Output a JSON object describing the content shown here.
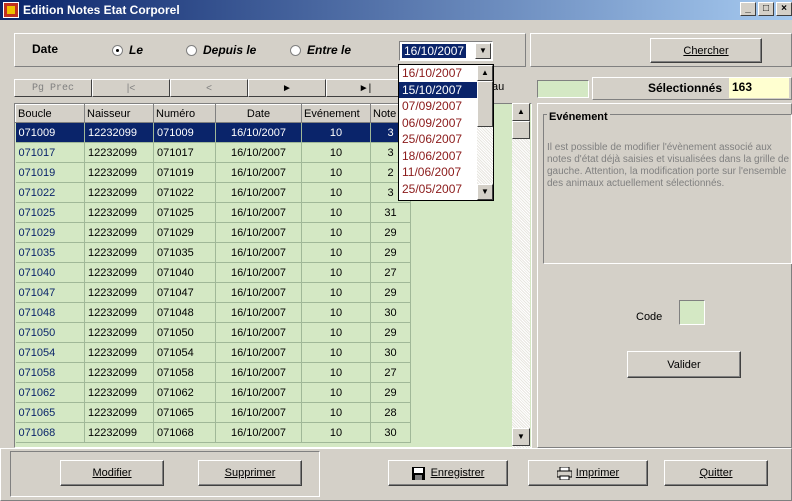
{
  "window": {
    "title": "Edition Notes Etat Corporel"
  },
  "date_filter": {
    "label": "Date",
    "options": [
      "Le",
      "Depuis le",
      "Entre le"
    ],
    "selected_index": 0,
    "current_date": "16/10/2007",
    "search_button": "Chercher"
  },
  "dropdown": {
    "items": [
      "16/10/2007",
      "15/10/2007",
      "07/09/2007",
      "06/09/2007",
      "25/06/2007",
      "18/06/2007",
      "11/06/2007",
      "25/05/2007"
    ],
    "highlighted_index": 1
  },
  "navigation": {
    "prev_page": "Pg Prec",
    "first": "|<",
    "prev": "<",
    "next": "►",
    "last": "►|",
    "aller_au": "Aller au"
  },
  "selection": {
    "label": "Sélectionnés",
    "count": "163"
  },
  "grid": {
    "columns": [
      "Boucle",
      "Naisseur",
      "Numéro",
      "Date",
      "Evénement",
      "Note"
    ],
    "rows": [
      [
        "071009",
        "12232099",
        "071009",
        "16/10/2007",
        "10",
        "3"
      ],
      [
        "071017",
        "12232099",
        "071017",
        "16/10/2007",
        "10",
        "3"
      ],
      [
        "071019",
        "12232099",
        "071019",
        "16/10/2007",
        "10",
        "2"
      ],
      [
        "071022",
        "12232099",
        "071022",
        "16/10/2007",
        "10",
        "3"
      ],
      [
        "071025",
        "12232099",
        "071025",
        "16/10/2007",
        "10",
        "31"
      ],
      [
        "071029",
        "12232099",
        "071029",
        "16/10/2007",
        "10",
        "29"
      ],
      [
        "071035",
        "12232099",
        "071035",
        "16/10/2007",
        "10",
        "29"
      ],
      [
        "071040",
        "12232099",
        "071040",
        "16/10/2007",
        "10",
        "27"
      ],
      [
        "071047",
        "12232099",
        "071047",
        "16/10/2007",
        "10",
        "29"
      ],
      [
        "071048",
        "12232099",
        "071048",
        "16/10/2007",
        "10",
        "30"
      ],
      [
        "071050",
        "12232099",
        "071050",
        "16/10/2007",
        "10",
        "29"
      ],
      [
        "071054",
        "12232099",
        "071054",
        "16/10/2007",
        "10",
        "30"
      ],
      [
        "071058",
        "12232099",
        "071058",
        "16/10/2007",
        "10",
        "27"
      ],
      [
        "071062",
        "12232099",
        "071062",
        "16/10/2007",
        "10",
        "29"
      ],
      [
        "071065",
        "12232099",
        "071065",
        "16/10/2007",
        "10",
        "28"
      ],
      [
        "071068",
        "12232099",
        "071068",
        "16/10/2007",
        "10",
        "30"
      ]
    ],
    "selected_row": 0
  },
  "event_panel": {
    "title": "Evénement",
    "help_text": "Il est possible de modifier l'évènement associé aux notes d'état déjà saisies et visualisées dans la grille de gauche. Attention, la modification porte sur l'ensemble des animaux actuellement sélectionnés.",
    "code_label": "Code",
    "validate_button": "Valider"
  },
  "footer": {
    "modify": "Modifier",
    "delete": "Supprimer",
    "save": "Enregistrer",
    "print": "Imprimer",
    "quit": "Quitter"
  }
}
